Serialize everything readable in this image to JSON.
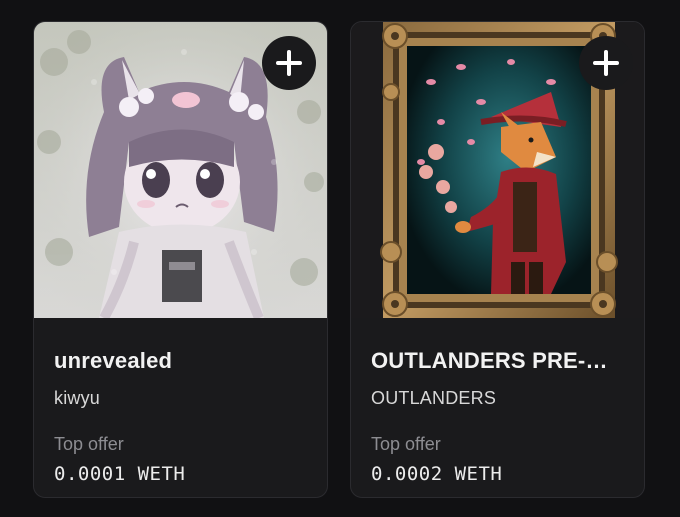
{
  "cards": [
    {
      "title": "unrevealed",
      "collection": "kiwyu",
      "offer_label": "Top offer",
      "offer_value": "0.0001 WETH",
      "image": "pastel chibi girl with cat ears artwork",
      "add_icon": "plus-icon"
    },
    {
      "title": "OUTLANDERS PRE-…",
      "collection": "OUTLANDERS",
      "offer_label": "Top offer",
      "offer_value": "0.0002 WETH",
      "image": "fox gentleman in red coat inside ornate gold frame",
      "add_icon": "plus-icon"
    }
  ],
  "colors": {
    "background": "#111113",
    "card": "#1a1a1c",
    "title": "#f2f2f2",
    "muted": "#8d8d92"
  }
}
